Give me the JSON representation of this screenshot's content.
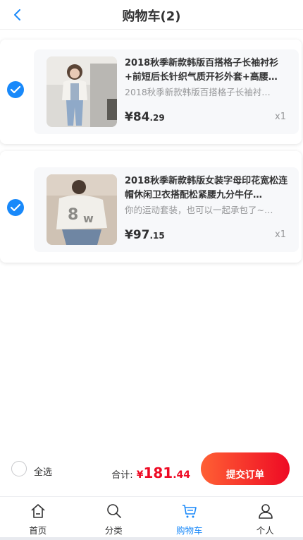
{
  "nav": {
    "title": "购物车(2)",
    "back_icon": "chevron-left-icon"
  },
  "colors": {
    "accent": "#1989fa",
    "price_red": "#ee0a24",
    "button_gradient_start": "#ff6034",
    "button_gradient_end": "#ee0a24"
  },
  "cart_items": [
    {
      "checked": true,
      "title": "2018秋季新款韩版百搭格子长袖衬衫+前短后长针织气质开衫外套+高腰…",
      "desc": "2018秋季新款韩版百搭格子长袖衬…",
      "price_currency": "¥",
      "price_int": "¥84",
      "price_dec": ".29",
      "num": "x1"
    },
    {
      "checked": true,
      "title": "2018秋季新款韩版女装字母印花宽松连帽休闲卫衣搭配松紧腰九分牛仔…",
      "desc": "你的运动套装，也可以一起承包了~…",
      "price_currency": "¥",
      "price_int": "¥97",
      "price_dec": ".15",
      "num": "x1"
    }
  ],
  "submit_bar": {
    "select_all_label": "全选",
    "total_label": "合计:",
    "total_currency": "¥",
    "total_int": "181",
    "total_dec": ".44",
    "button_label": "提交订单"
  },
  "tabbar": [
    {
      "label": "首页",
      "icon": "home-icon",
      "active": false
    },
    {
      "label": "分类",
      "icon": "search-icon",
      "active": false
    },
    {
      "label": "购物车",
      "icon": "cart-icon",
      "active": true
    },
    {
      "label": "个人",
      "icon": "user-icon",
      "active": false
    }
  ]
}
